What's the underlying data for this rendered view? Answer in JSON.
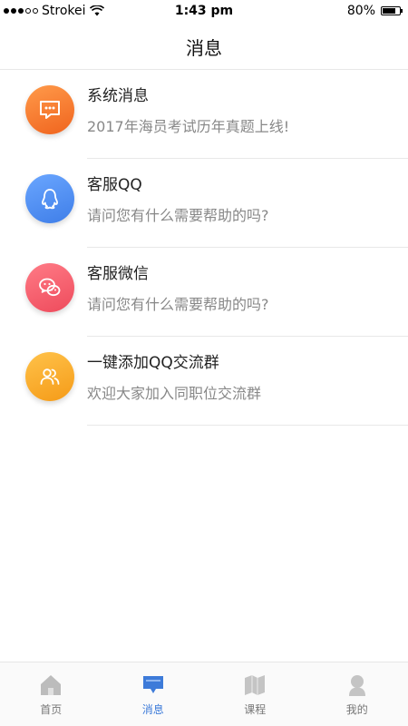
{
  "status_bar": {
    "carrier": "Strokei",
    "time": "1:43 pm",
    "battery": "80%",
    "battery_level": 0.8
  },
  "nav": {
    "title": "消息"
  },
  "messages": [
    {
      "title": "系统消息",
      "subtitle": "2017年海员考试历年真题上线!",
      "icon": "chat-bubble-icon",
      "color": "#f47a2d"
    },
    {
      "title": "客服QQ",
      "subtitle": "请问您有什么需要帮助的吗?",
      "icon": "qq-penguin-icon",
      "color": "#4d8ef0"
    },
    {
      "title": "客服微信",
      "subtitle": "请问您有什么需要帮助的吗?",
      "icon": "wechat-icon",
      "color": "#f25a6a"
    },
    {
      "title": "一键添加QQ交流群",
      "subtitle": "欢迎大家加入同职位交流群",
      "icon": "group-users-icon",
      "color": "#f7a623"
    }
  ],
  "tabs": [
    {
      "label": "首页",
      "icon": "home-icon",
      "active": false
    },
    {
      "label": "消息",
      "icon": "message-icon",
      "active": true
    },
    {
      "label": "课程",
      "icon": "book-icon",
      "active": false
    },
    {
      "label": "我的",
      "icon": "profile-icon",
      "active": false
    }
  ],
  "colors": {
    "accent": "#3d7bd9",
    "inactive_tab": "#9a9a9a"
  }
}
